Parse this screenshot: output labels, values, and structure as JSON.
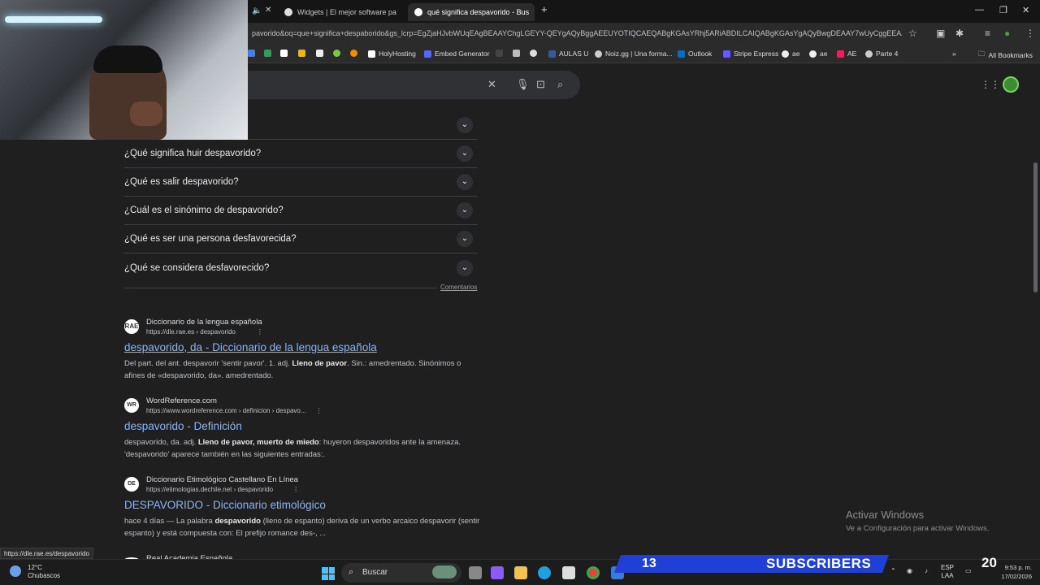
{
  "tabs": [
    {
      "label": "Widgets | El mejor software pa"
    },
    {
      "label": "qué significa despavorido - Bus",
      "active": true
    }
  ],
  "url": "pavorido&oq=que+significa+despaborido&gs_lcrp=EgZjaHJvbWUqEAgBEAAYChgLGEYY-QEYgAQyBggAEEUYOTIQCAEQABgKGAsYRhj5ARiABDILCAIQABgKGAsYgAQyBwgDEAAY7wUyCggEEAAYg...",
  "bookmarks": [
    {
      "label": "HolyHosting",
      "color": "#ffffff"
    },
    {
      "label": "Embed Generator",
      "color": "#5865f2"
    },
    {
      "label": "AULAS U",
      "color": "#3b5998"
    },
    {
      "label": "Noiz.gg | Una forma...",
      "color": "#cccccc"
    },
    {
      "label": "Outlook",
      "color": "#0f6cbd"
    },
    {
      "label": "Stripe Express",
      "color": "#635bff"
    },
    {
      "label": "ae",
      "color": "#eeeeee"
    },
    {
      "label": "ae",
      "color": "#eeeeee"
    },
    {
      "label": "AE",
      "color": "#e0245e"
    },
    {
      "label": "Parte 4",
      "color": "#cccccc"
    }
  ],
  "all_bookmarks": "All Bookmarks",
  "paa": [
    "¿Qué significa huir despavorido?",
    "¿Qué es salir despavorido?",
    "¿Cuál es el sinónimo de despavorido?",
    "¿Qué es ser una persona desfavorecida?",
    "¿Qué se considera desfavorecido?"
  ],
  "comentarios": "Comentarios",
  "results": [
    {
      "icon": "RAE",
      "site": "Diccionario de la lengua española",
      "cite": "https://dle.rae.es › despavorido",
      "title": "despavorido, da - Diccionario de la lengua española",
      "snippet_parts": [
        "Del part. del ant. despavorir 'sentir pavor'. 1. adj. ",
        "Lleno de pavor",
        ". Sin.: amedrentado. Sinónimos o afines de «despavorido, da». amedrentado."
      ]
    },
    {
      "icon": "WR",
      "site": "WordReference.com",
      "cite": "https://www.wordreference.com › definicion › despavo...",
      "title": "despavorido - Definición",
      "snippet_parts": [
        "despavorido, da. adj. ",
        "Lleno de pavor, muerto de miedo",
        ": huyeron despavoridos ante la amenaza. 'despavorido' aparece también en las siguientes entradas:."
      ]
    },
    {
      "icon": "DE",
      "site": "Diccionario Etimológico Castellano En Línea",
      "cite": "https://etimologias.dechile.net › despavorido",
      "title": "DESPAVORIDO - Diccionario etimológico",
      "snippet_parts": [
        "hace 4 días — La palabra ",
        "despavorido",
        " (lleno de espanto) deriva de un verbo arcaico despavorir (sentir espanto) y está compuesta con: El prefijo romance des-, ..."
      ]
    }
  ],
  "partial_result_site": "Real Academia Española",
  "status_url": "https://dle.rae.es/despavorido",
  "activate": {
    "title": "Activar Windows",
    "subtitle": "Ve a Configuración para activar Windows."
  },
  "taskbar": {
    "weather_temp": "12°C",
    "weather_desc": "Chubascos",
    "search_label": "Buscar",
    "lang1": "ESP",
    "lang2": "LAA",
    "time": "9:53 p. m.",
    "date": "17/02/2026"
  },
  "overlay": {
    "subs_count": "13",
    "subs_label": "SUBSCRIBERS",
    "big_number": "20"
  }
}
